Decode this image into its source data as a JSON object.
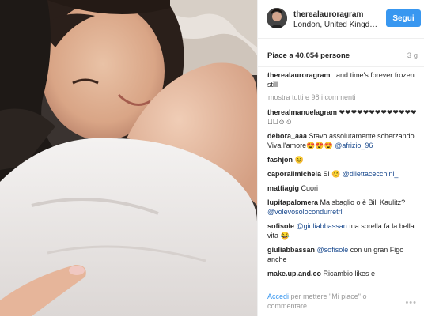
{
  "header": {
    "username": "therealauroragram",
    "location": "London, United Kingd…",
    "follow_label": "Segui"
  },
  "stats": {
    "likes": "Piace a 40.054 persone",
    "time": "3 g"
  },
  "caption": {
    "user": "therealauroragram",
    "text": " ..and time's forever frozen still"
  },
  "load_more": "mostra tutti e 98 i commenti",
  "comments": [
    {
      "user": "therealmanuelagram",
      "text": " ❤❤❤❤❤❤❤❤❤❤❤❤❤❤🏼☺☺"
    },
    {
      "user": "debora_aaa",
      "text": " Stavo assolutamente scherzando. Viva l'amore😍😍😍 ",
      "mention": "@afrizio_96"
    },
    {
      "user": "fashjon",
      "text": " 😊"
    },
    {
      "user": "caporalimichela",
      "text": " Si 😊 ",
      "mention": "@dilettacecchini_"
    },
    {
      "user": "mattiagig",
      "text": " Cuori"
    },
    {
      "user": "lupitapalomera",
      "text": " Ma sbaglio o è Bill Kaulitz? ",
      "mention": "@volevosolocondurretrl"
    },
    {
      "user": "sofisole",
      "text": " ",
      "mention": "@giuliabbassan",
      "after": " tua sorella fa la bella vita 😂"
    },
    {
      "user": "giuliabbassan",
      "text": " ",
      "mention": "@sofisole",
      "after": " con un gran Figo anche"
    },
    {
      "user": "make.up.and.co",
      "text": " Ricambio likes e"
    }
  ],
  "footer": {
    "login_link": "Accedi",
    "login_text": " per mettere \"Mi piace\" o commentare.",
    "more_icon": "ellipsis-icon"
  },
  "colors": {
    "accent": "#3897f0",
    "mention": "#1b4b8f",
    "muted": "#999999",
    "text": "#262626"
  }
}
